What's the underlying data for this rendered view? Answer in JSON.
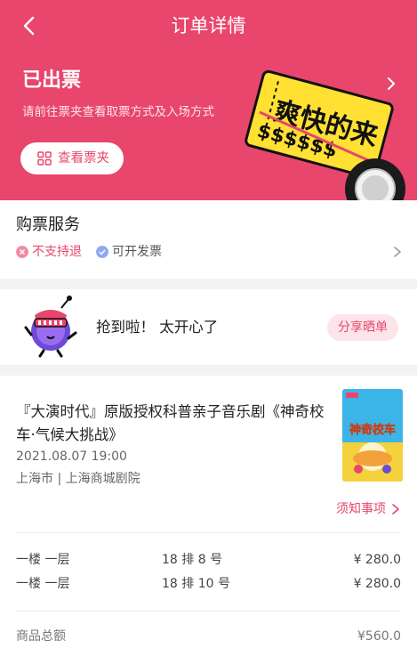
{
  "nav": {
    "title": "订单详情"
  },
  "status": {
    "title": "已出票",
    "subtitle": "请前往票夹查看取票方式及入场方式",
    "button_label": "查看票夹"
  },
  "promo": {
    "text": "爽快的来",
    "symbols": "$$$$$$"
  },
  "service": {
    "title": "购票服务",
    "items": [
      {
        "label": "不支持退",
        "icon": "x-circle-icon"
      },
      {
        "label": "可开发票",
        "icon": "check-circle-icon"
      }
    ]
  },
  "share": {
    "text": "抢到啦！  太开心了",
    "button_label": "分享晒单"
  },
  "show": {
    "title": "『大演时代』原版授权科普亲子音乐剧《神奇校车·气候大挑战》",
    "date": "2021.08.07 19:00",
    "venue": "上海市 | 上海商城剧院",
    "poster_text": "神奇校车",
    "notice_label": "须知事项"
  },
  "tickets": [
    {
      "area": "一楼 一层",
      "seat": "18 排 8 号",
      "price": "¥ 280.0"
    },
    {
      "area": "一楼 一层",
      "seat": "18 排 10 号",
      "price": "¥ 280.0"
    }
  ],
  "summary": {
    "label": "商品总额",
    "value": "¥560.0"
  },
  "colors": {
    "brand": "#e8466d",
    "promo_yellow": "#ffe033"
  }
}
